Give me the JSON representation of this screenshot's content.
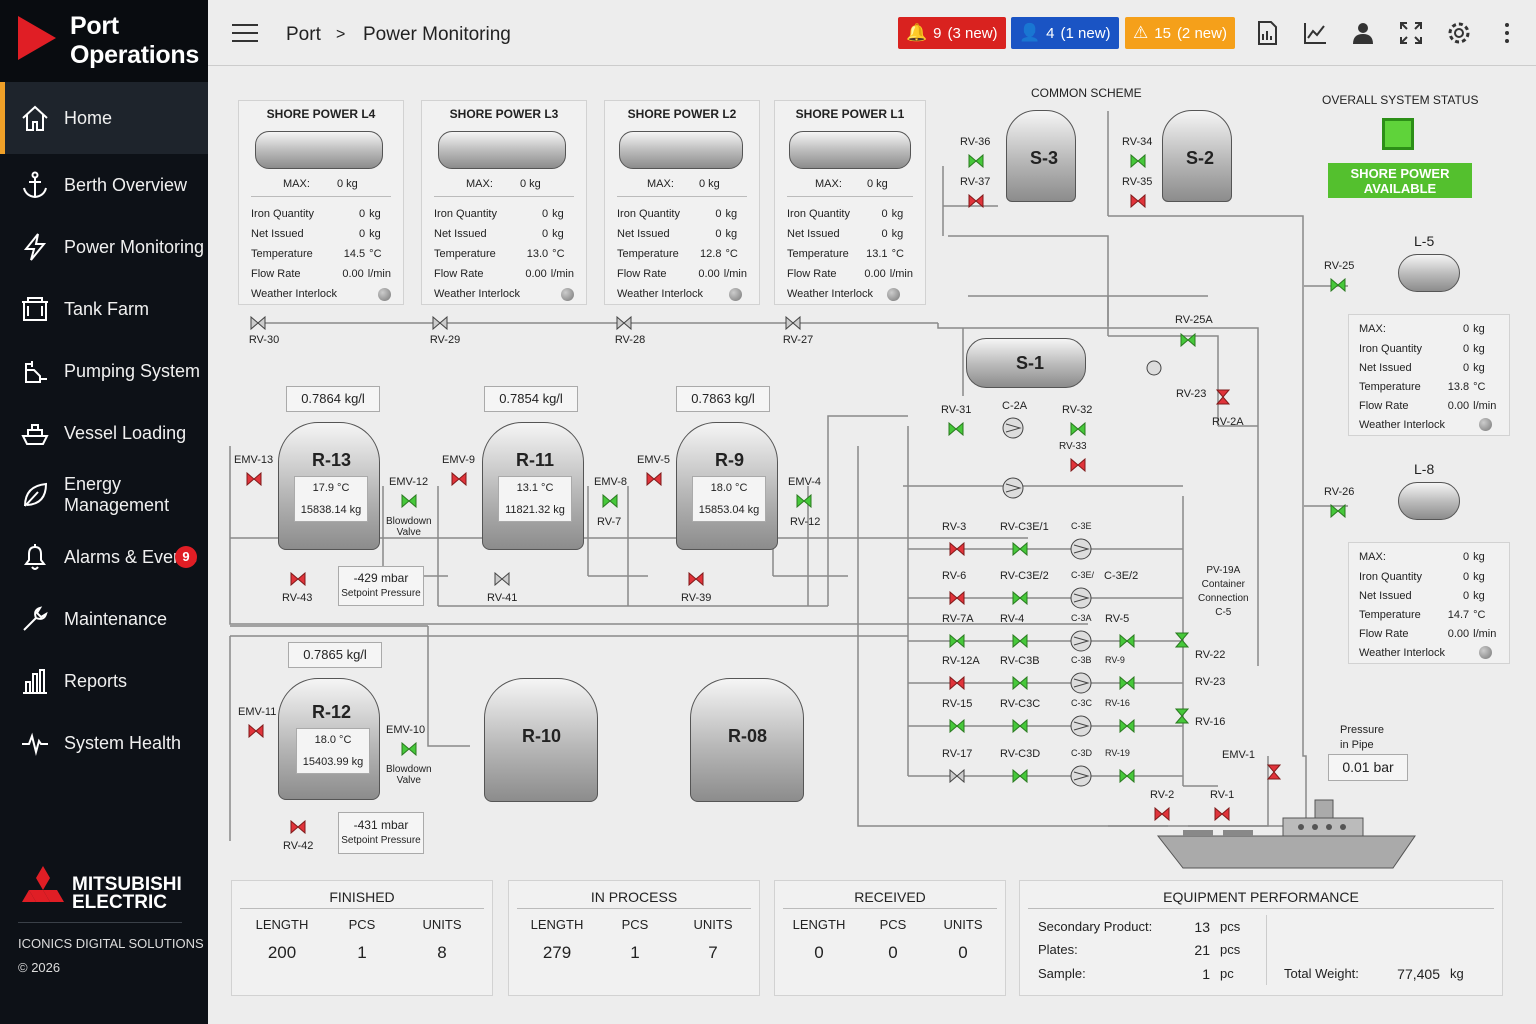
{
  "brand": {
    "title": "Port\nOperations"
  },
  "nav": [
    {
      "label": "Home",
      "icon": "home-icon",
      "active": true
    },
    {
      "label": "Berth Overview",
      "icon": "anchor-icon"
    },
    {
      "label": "Power Monitoring",
      "icon": "lightning-icon"
    },
    {
      "label": "Tank Farm",
      "icon": "tank-icon"
    },
    {
      "label": "Pumping System",
      "icon": "pump-icon"
    },
    {
      "label": "Vessel Loading",
      "icon": "ship-icon"
    },
    {
      "label": "Energy Management",
      "icon": "leaf-icon"
    },
    {
      "label": "Alarms & Events",
      "icon": "bell-icon",
      "badge": "9"
    },
    {
      "label": "Maintenance",
      "icon": "wrench-icon"
    },
    {
      "label": "Reports",
      "icon": "bar-chart-icon"
    },
    {
      "label": "System Health",
      "icon": "heartbeat-icon"
    }
  ],
  "footer": {
    "logo_text": "MITSUBISHI\nELECTRIC",
    "company": "ICONICS DIGITAL SOLUTIONS",
    "copyright": "© 2026"
  },
  "header": {
    "crumb_root": "Port",
    "crumb_sep": ">",
    "crumb_page": "Power Monitoring",
    "alarms": {
      "count": "9",
      "new": "(3 new)",
      "color": "#d9221f"
    },
    "users": {
      "count": "4",
      "new": "(1 new)",
      "color": "#1a54c4"
    },
    "warnings": {
      "count": "15",
      "new": "(2 new)",
      "color": "#f5a01a"
    }
  },
  "shore_power": [
    {
      "title": "SHORE POWER L4",
      "max": "0 kg",
      "iron": "0",
      "net": "0",
      "temp": "14.5",
      "flow": "0.00"
    },
    {
      "title": "SHORE POWER L3",
      "max": "0 kg",
      "iron": "0",
      "net": "0",
      "temp": "13.0",
      "flow": "0.00"
    },
    {
      "title": "SHORE POWER L2",
      "max": "0 kg",
      "iron": "0",
      "net": "0",
      "temp": "12.8",
      "flow": "0.00"
    },
    {
      "title": "SHORE POWER L1",
      "max": "0 kg",
      "iron": "0",
      "net": "0",
      "temp": "13.1",
      "flow": "0.00"
    }
  ],
  "labels": {
    "max": "MAX:",
    "iron": "Iron Quantity",
    "net": "Net Issued",
    "temp": "Temperature",
    "flow": "Flow Rate",
    "interlock": "Weather Interlock",
    "kg": "kg",
    "degc": "°C",
    "lmin": "l/min",
    "kgl": "kg/l",
    "mbar": "mbar",
    "setpoint": "Setpoint Pressure",
    "blowdown": "Blowdown\nValve"
  },
  "scheme": {
    "common": "COMMON SCHEME",
    "s3": "S-3",
    "s2": "S-2",
    "s1": "S-1"
  },
  "status": {
    "title": "OVERALL SYSTEM STATUS",
    "text": "SHORE POWER\nAVAILABLE",
    "color": "#54c02e"
  },
  "l_tanks": [
    {
      "name": "L-5",
      "valve": "RV-25",
      "max": "0",
      "iron": "0",
      "net": "0",
      "temp": "13.8",
      "flow": "0.00"
    },
    {
      "name": "L-8",
      "valve": "RV-26",
      "max": "0",
      "iron": "0",
      "net": "0",
      "temp": "14.7",
      "flow": "0.00"
    }
  ],
  "reactors": [
    {
      "name": "R-13",
      "density": "0.7864",
      "temp": "17.9 °C",
      "mass": "15838.14 kg",
      "emv_in": "EMV-13",
      "emv_out": "EMV-12",
      "rv": "RV-43",
      "pressure": "-429"
    },
    {
      "name": "R-11",
      "density": "0.7854",
      "temp": "13.1 °C",
      "mass": "11821.32 kg",
      "emv_in": "EMV-9",
      "emv_out": "EMV-8",
      "rv": "RV-41",
      "rv_side": "RV-7"
    },
    {
      "name": "R-9",
      "density": "0.7863",
      "temp": "18.0 °C",
      "mass": "15853.04 kg",
      "emv_in": "EMV-5",
      "emv_out": "EMV-4",
      "rv": "RV-39",
      "rv_side": "RV-12"
    },
    {
      "name": "R-12",
      "density": "0.7865",
      "temp": "18.0 °C",
      "mass": "15403.99 kg",
      "emv_in": "EMV-11",
      "emv_out": "EMV-10",
      "rv": "RV-42",
      "pressure": "-431"
    },
    {
      "name": "R-10"
    },
    {
      "name": "R-08"
    }
  ],
  "line_valves": [
    "RV-30",
    "RV-29",
    "RV-28",
    "RV-27"
  ],
  "manifold": {
    "rows": [
      {
        "a": "RV-3",
        "b": "RV-C3E/1",
        "p": "C-3E"
      },
      {
        "a": "RV-6",
        "b": "RV-C3E/2",
        "p": "C-3E/",
        "c": "C-3E/2"
      },
      {
        "a": "RV-7A",
        "b": "RV-4",
        "p": "C-3A",
        "c": "RV-5"
      },
      {
        "a": "RV-12A",
        "b": "RV-C3B",
        "p": "C-3B",
        "c": "RV-9"
      },
      {
        "a": "RV-15",
        "b": "RV-C3C",
        "p": "C-3C",
        "c": "RV-16"
      },
      {
        "a": "RV-17",
        "b": "RV-C3D",
        "p": "C-3D",
        "c": "RV-19"
      }
    ],
    "top": {
      "rv31": "RV-31",
      "c2a": "C-2A",
      "rv32": "RV-32",
      "rv33": "RV-33",
      "rv36": "RV-36",
      "rv37": "RV-37",
      "rv34": "RV-34",
      "rv35": "RV-35",
      "rv25a": "RV-25A",
      "rv23a": "RV-23",
      "rv2a": "RV-2A"
    },
    "right": {
      "pv": "PV-19A\nContainer\nConnection\nC-5",
      "rv22": "RV-22",
      "rv23": "RV-23",
      "rv16": "RV-16",
      "emv1": "EMV-1",
      "rv2": "RV-2",
      "rv1": "RV-1"
    }
  },
  "pipe_pressure": {
    "label": "Pressure\nin Pipe",
    "value": "0.01",
    "unit": "bar"
  },
  "stats": [
    {
      "title": "FINISHED",
      "length": "200",
      "pcs": "1",
      "units": "8"
    },
    {
      "title": "IN PROCESS",
      "length": "279",
      "pcs": "1",
      "units": "7"
    },
    {
      "title": "RECEIVED",
      "length": "0",
      "pcs": "0",
      "units": "0"
    }
  ],
  "stat_cols": {
    "length": "LENGTH",
    "pcs": "PCS",
    "units": "UNITS"
  },
  "equipment": {
    "title": "EQUIPMENT PERFORMANCE",
    "secondary_label": "Secondary Product:",
    "secondary": "13",
    "secondary_unit": "pcs",
    "plates_label": "Plates:",
    "plates": "21",
    "plates_unit": "pcs",
    "sample_label": "Sample:",
    "sample": "1",
    "sample_unit": "pc",
    "total_label": "Total Weight:",
    "total": "77,405",
    "total_unit": "kg"
  }
}
